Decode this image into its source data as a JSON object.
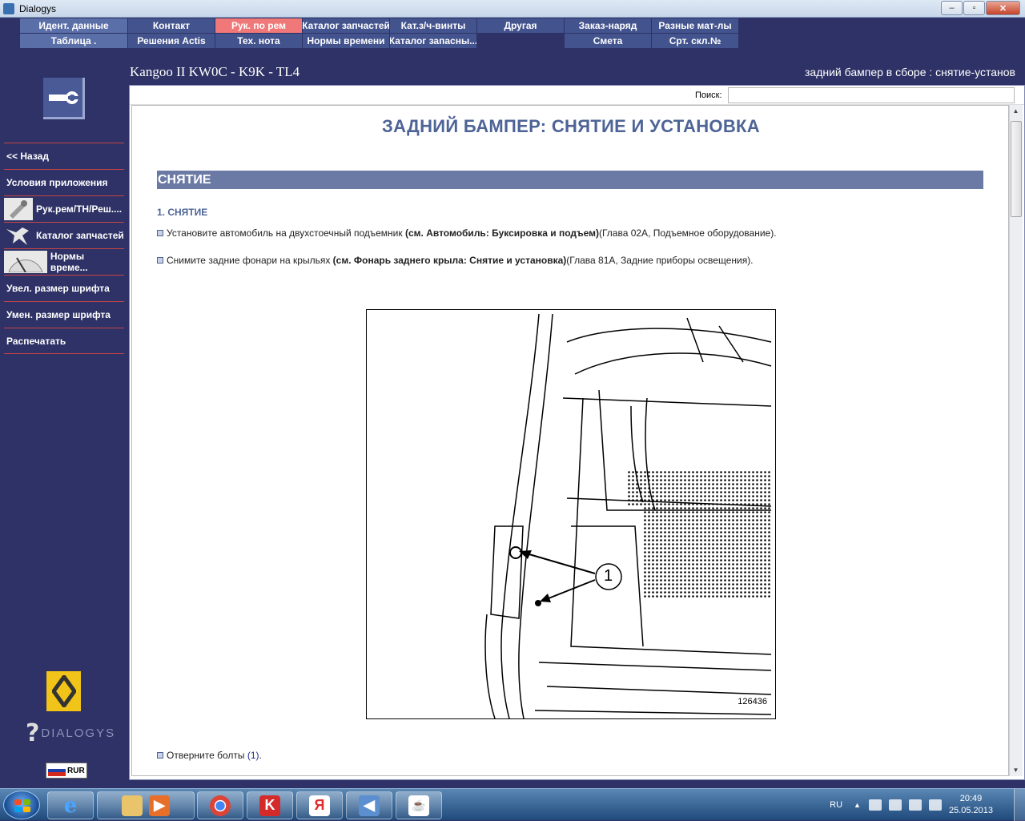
{
  "window": {
    "title": "Dialogys",
    "controls": [
      "–",
      "▫",
      "✕"
    ]
  },
  "top_menu": {
    "row1": [
      "Идент. данные",
      "Контакт",
      "Рук. по рем",
      "Каталог запчастей",
      "Кат.з/ч-винты",
      "Другая",
      "Заказ-наряд",
      "Разные мат-лы"
    ],
    "row2": [
      "Таблица .",
      "Решения Actis",
      "Тех. нота",
      "Нормы времени",
      "Каталог запасны...",
      "",
      "Смета",
      "Срт. скл.№"
    ],
    "active": "Рук. по рем"
  },
  "header": {
    "vehicle": "Kangoo II KW0C - K9K - TL4",
    "breadcrumb": "задний бампер в сборе : снятие-установ"
  },
  "sidebar": {
    "items": [
      {
        "label": "<< Назад"
      },
      {
        "label": "Условия приложения"
      },
      {
        "label": "Рук.рем/TH/Реш...."
      },
      {
        "label": "Каталог запчастей"
      },
      {
        "label": "Нормы време..."
      },
      {
        "label": "Увел. размер шрифта"
      },
      {
        "label": "Умен. размер шрифта"
      },
      {
        "label": "Распечатать"
      }
    ],
    "brand_word": "DIALOGYS",
    "currency": "RUR"
  },
  "search": {
    "label": "Поиск:",
    "value": ""
  },
  "document": {
    "title": "ЗАДНИЙ БАМПЕР: СНЯТИЕ И УСТАНОВКА",
    "section": "СНЯТИЕ",
    "subheading": "1. СНЯТИЕ",
    "steps": [
      {
        "text": "Установите автомобиль на двухстоечный подъемник ",
        "ref": "(см. Автомобиль: Буксировка и подъем)",
        "tail": " (Глава 02A, Подъемное оборудование)."
      },
      {
        "text": "Снимите задние фонари на крыльях ",
        "ref": "(см. Фонарь заднего крыла: Снятие и установка)",
        "tail": " (Глава 81A, Задние приборы освещения)."
      }
    ],
    "figure": {
      "callout": "1",
      "number": "126436"
    },
    "after_figure": {
      "text": "Отверните болты ",
      "ref": "(1)",
      "tail": " ."
    }
  },
  "taskbar": {
    "language": "RU",
    "time": "20:49",
    "date": "25.05.2013"
  },
  "colors": {
    "sidebar_bg": "#2e3266",
    "active_tab": "#f07878",
    "title_blue": "#4e6496",
    "separator": "#c64545"
  }
}
